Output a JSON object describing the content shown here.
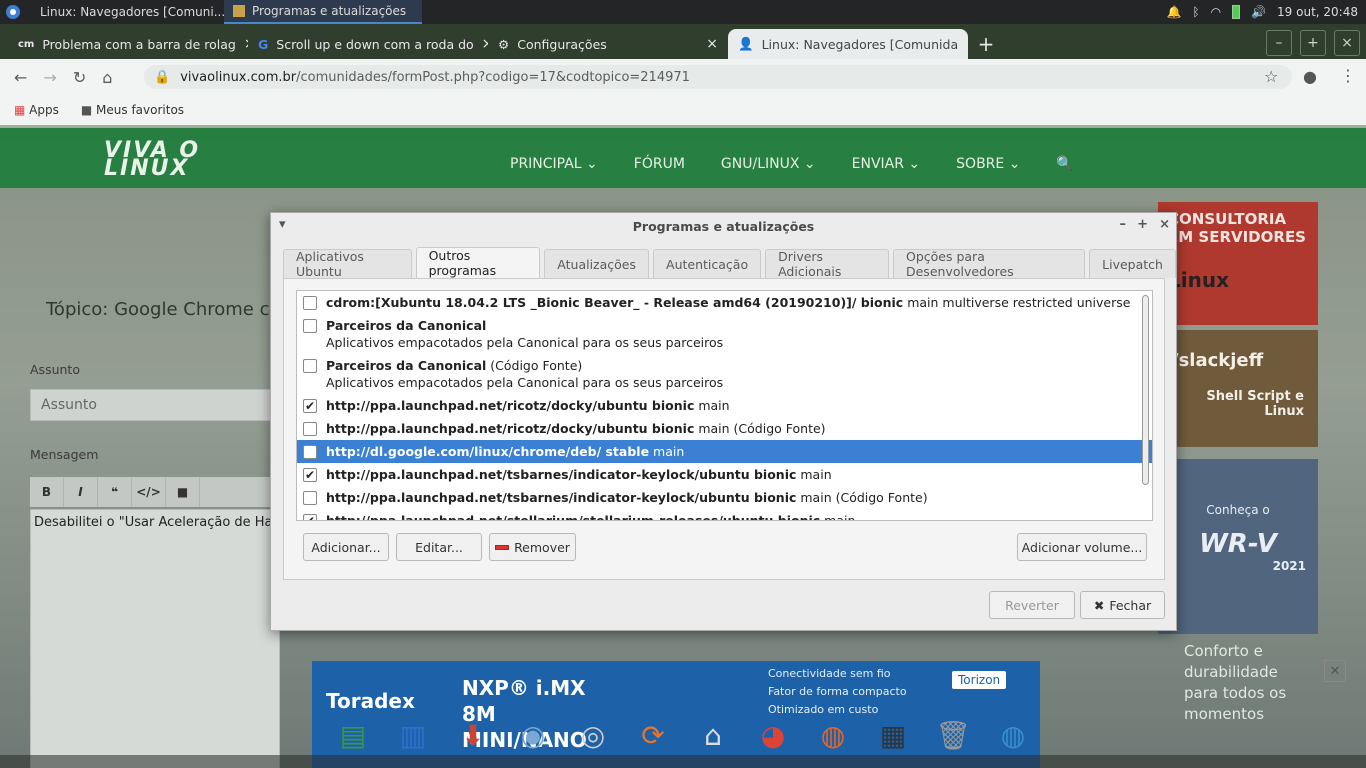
{
  "panel": {
    "tasks": [
      "Linux: Navegadores [Comuni...",
      "Programas e atualizações"
    ],
    "clock": "19 out, 20:48"
  },
  "browser": {
    "tabs": [
      "Problema com a barra de rolag",
      "Scroll up e down com a roda do",
      "Configurações",
      "Linux: Navegadores [Comunida"
    ],
    "tab_icons": [
      "cm",
      "G",
      "gear",
      "person"
    ],
    "url_host": "vivaolinux.com.br",
    "url_path": "/comunidades/formPost.php?codigo=17&codtopico=214971",
    "bookmarks": [
      "Apps",
      "Meus favoritos"
    ]
  },
  "site": {
    "logo_line1": "VIVA O",
    "logo_line2": "LINUX",
    "nav": [
      "PRINCIPAL ⌄",
      "FÓRUM",
      "GNU/LINUX ⌄",
      "ENVIAR ⌄",
      "SOBRE ⌄"
    ],
    "topic_title": "Tópico: Google Chrome c",
    "subject_label": "Assunto",
    "subject_placeholder": "Assunto",
    "message_label": "Mensagem",
    "editor_buttons": [
      "B",
      "I",
      "❝",
      "</>",
      "■"
    ],
    "message_text": "Desabilitei o \"Usar Aceleração de Hard",
    "ad1": "CONSULTORIA EM SERVIDORES",
    "ad1_b": "Linux",
    "ad2": "/slackjeff",
    "ad2_b": "Shell Script e Linux",
    "ad3_a": "Conheça o",
    "ad3_b": "WR-V",
    "ad3_c": "2021",
    "ad4": "Conforto e durabilidade para todos os momentos"
  },
  "dialog": {
    "title": "Programas e atualizações",
    "tabs": [
      "Aplicativos Ubuntu",
      "Outros programas",
      "Atualizações",
      "Autenticação",
      "Drivers Adicionais",
      "Opções para Desenvolvedores",
      "Livepatch"
    ],
    "active_tab": 1,
    "sources": [
      {
        "main": "cdrom:[Xubuntu 18.04.2 LTS _Bionic Beaver_ - Release amd64 (20190210)]/ bionic",
        "rest": " main multiverse restricted universe",
        "desc": "",
        "checked": false,
        "selected": false
      },
      {
        "main": "Parceiros da Canonical",
        "rest": "",
        "desc": "Aplicativos empacotados pela Canonical para os seus parceiros",
        "checked": false,
        "selected": false
      },
      {
        "main": "Parceiros da Canonical",
        "rest": " (Código Fonte)",
        "desc": "Aplicativos empacotados pela Canonical para os seus parceiros",
        "checked": false,
        "selected": false
      },
      {
        "main": "http://ppa.launchpad.net/ricotz/docky/ubuntu bionic",
        "rest": " main",
        "desc": "",
        "checked": true,
        "selected": false
      },
      {
        "main": "http://ppa.launchpad.net/ricotz/docky/ubuntu bionic",
        "rest": " main (Código Fonte)",
        "desc": "",
        "checked": false,
        "selected": false
      },
      {
        "main": "http://dl.google.com/linux/chrome/deb/ stable",
        "rest": " main",
        "desc": "",
        "checked": false,
        "selected": true
      },
      {
        "main": "http://ppa.launchpad.net/tsbarnes/indicator-keylock/ubuntu bionic",
        "rest": " main",
        "desc": "",
        "checked": true,
        "selected": false
      },
      {
        "main": "http://ppa.launchpad.net/tsbarnes/indicator-keylock/ubuntu bionic",
        "rest": " main (Código Fonte)",
        "desc": "",
        "checked": false,
        "selected": false
      },
      {
        "main": "http://ppa.launchpad.net/stellarium/stellarium-releases/ubuntu bionic",
        "rest": " main",
        "desc": "",
        "checked": true,
        "selected": false
      }
    ],
    "buttons": {
      "add": "Adicionar...",
      "edit": "Editar...",
      "remove": "Remover",
      "add_volume": "Adicionar volume...",
      "revert": "Reverter",
      "close": "Fechar"
    }
  },
  "dock": {
    "ad": {
      "brand": "Toradex",
      "product": "NXP® i.MX 8M MINI/NANO",
      "features": [
        "Conectividade sem fio",
        "Fator de forma compacto",
        "Otimizado em custo"
      ],
      "logo2": "Torizon"
    },
    "icons": [
      "spreadsheet-icon",
      "document-icon",
      "installer-icon",
      "software-center-icon",
      "disc-icon",
      "update-icon",
      "home-folder-icon",
      "chrome-icon",
      "firefox-icon",
      "calculator-icon",
      "trash-icon",
      "network-icon"
    ]
  }
}
